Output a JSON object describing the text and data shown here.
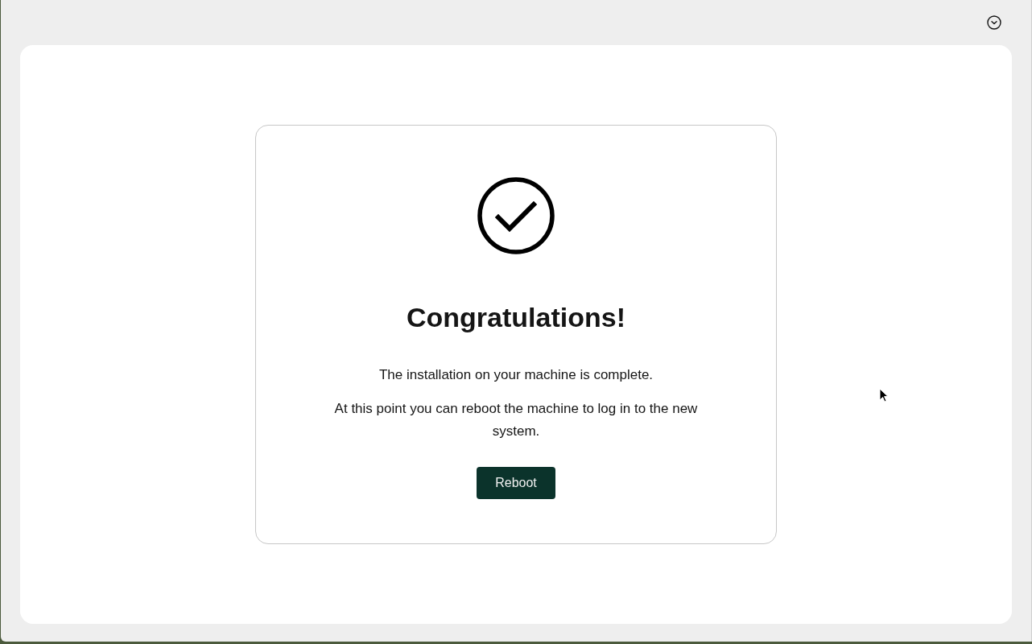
{
  "completion_card": {
    "title": "Congratulations!",
    "paragraphs": [
      "The installation on your machine is complete.",
      "At this point you can reboot the machine to log in to the new system."
    ],
    "button": "Reboot"
  }
}
